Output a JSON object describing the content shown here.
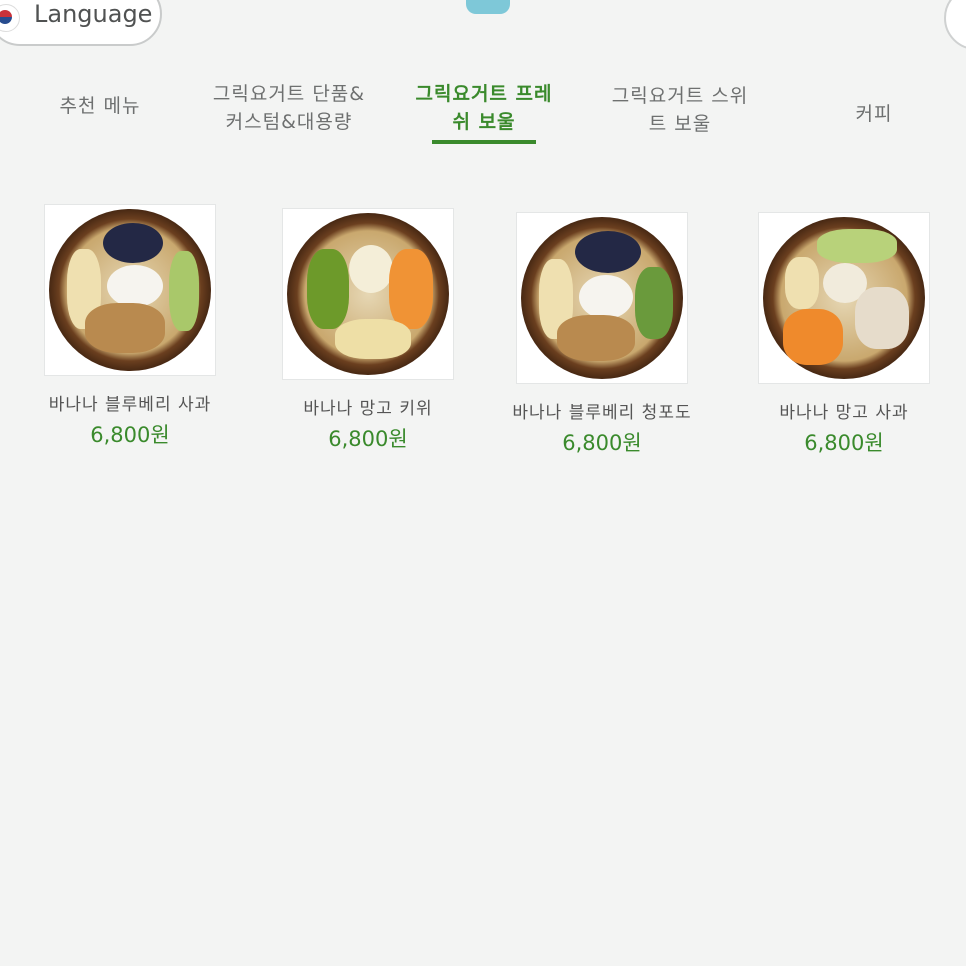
{
  "header": {
    "language_label": "Language"
  },
  "tabs": [
    {
      "line1": "추천 메뉴",
      "line2": ""
    },
    {
      "line1": "그릭요거트 단품&",
      "line2": "커스텀&대용량"
    },
    {
      "line1": "그릭요거트 프레",
      "line2": "쉬 보울"
    },
    {
      "line1": "그릭요거트 스위",
      "line2": "트 보울"
    },
    {
      "line1": "커피",
      "line2": ""
    }
  ],
  "active_tab_color": "#3a8a2c",
  "products": [
    {
      "name": "바나나 블루베리 사과",
      "price": "6,800원"
    },
    {
      "name": "바나나 망고 키위",
      "price": "6,800원"
    },
    {
      "name": "바나나 블루베리 청포도",
      "price": "6,800원"
    },
    {
      "name": "바나나 망고 사과",
      "price": "6,800원"
    }
  ]
}
